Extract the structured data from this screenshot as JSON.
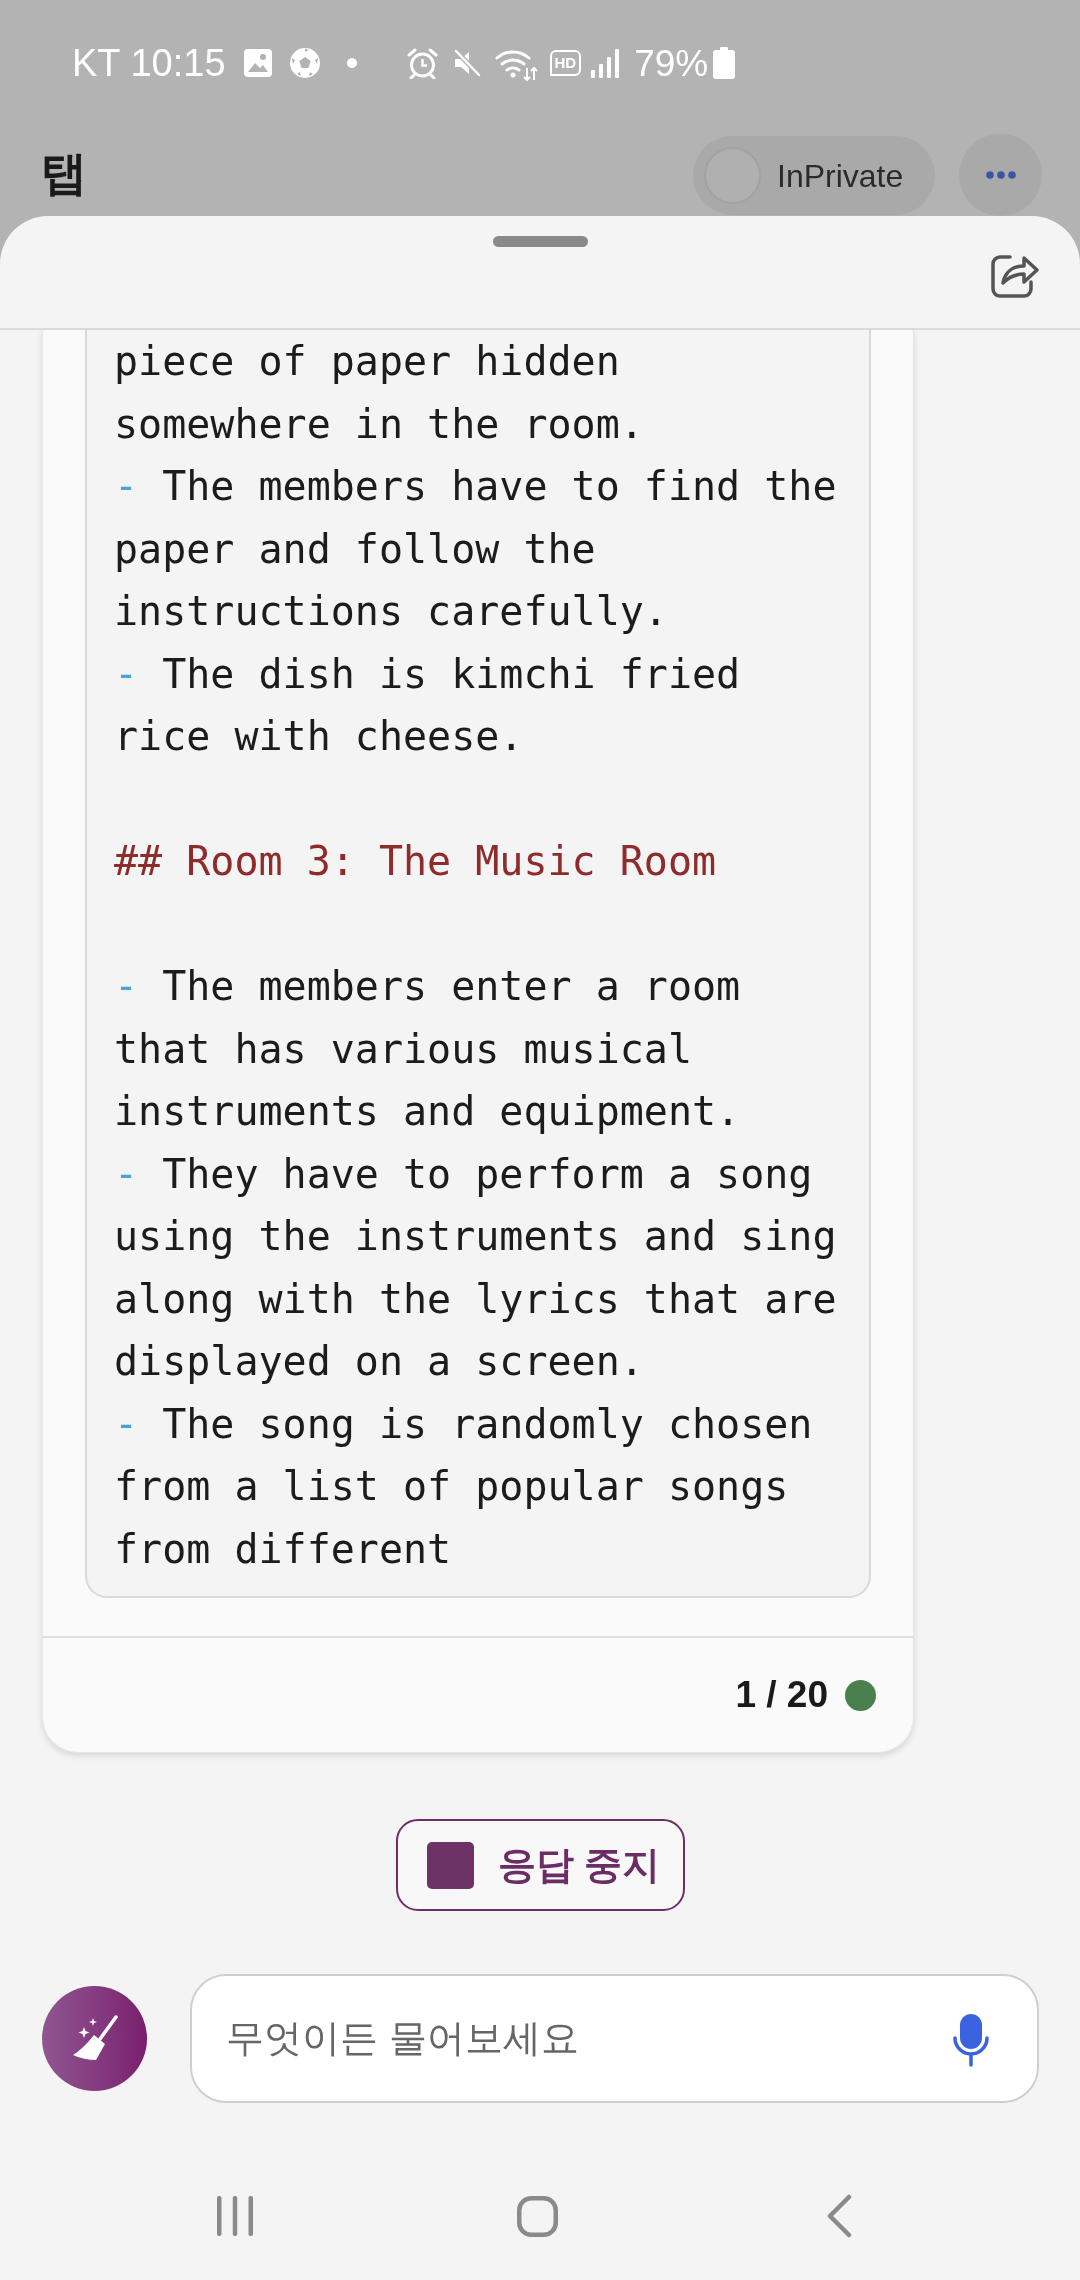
{
  "status_bar": {
    "carrier_time": "KT 10:15",
    "hd_indicator": "HD",
    "battery": "79%"
  },
  "header": {
    "title": "탭",
    "inprivate": {
      "label": "InPrivate",
      "on": false
    }
  },
  "chat": {
    "code_block": [
      {
        "kind": "text",
        "text": "piece of paper hidden somewhere in the room."
      },
      {
        "kind": "bullet",
        "marker": "-",
        "text": "The members have to find the paper and follow the instructions carefully."
      },
      {
        "kind": "bullet",
        "marker": "-",
        "text": "The dish is kimchi fried rice with cheese."
      },
      {
        "kind": "blank"
      },
      {
        "kind": "heading",
        "text": "## Room 3: The Music Room"
      },
      {
        "kind": "blank"
      },
      {
        "kind": "bullet",
        "marker": "-",
        "text": "The members enter a room that has various musical instruments and equipment."
      },
      {
        "kind": "bullet",
        "marker": "-",
        "text": "They have to perform a song using the instruments and sing along with the lyrics that are displayed on a screen."
      },
      {
        "kind": "bullet",
        "marker": "-",
        "text": "The song is randomly chosen from a list of popular songs from different"
      }
    ],
    "counter": "1 / 20"
  },
  "stop_button": {
    "label": "응답 중지"
  },
  "input": {
    "placeholder": "무엇이든 물어보세요"
  }
}
